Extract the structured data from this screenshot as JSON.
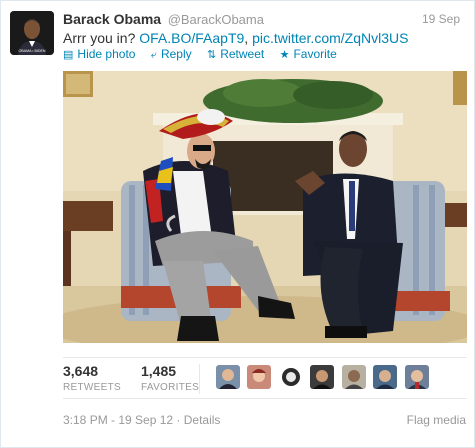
{
  "tweet": {
    "name": "Barack Obama",
    "handle": "@BarackObama",
    "date": "19 Sep",
    "text_prefix": "Arrr you in? ",
    "link1": "OFA.BO/FAapT9",
    "text_sep": ", ",
    "link2": "pic.twitter.com/ZqNvl3US",
    "avatar_caption": "OBAMA • BIDEN"
  },
  "actions": {
    "hide_photo": "Hide photo",
    "reply": "Reply",
    "retweet": "Retweet",
    "favorite": "Favorite"
  },
  "icons": {
    "hide_photo": "photo-icon",
    "reply": "reply-arrow-icon",
    "retweet": "retweet-icon",
    "favorite": "star-icon"
  },
  "stats": {
    "retweets_count": "3,648",
    "retweets_label": "RETWEETS",
    "favorites_count": "1,485",
    "favorites_label": "FAVORITES"
  },
  "footer": {
    "timestamp": "3:18 PM - 19 Sep 12",
    "separator": " · ",
    "details": "Details",
    "flag_media": "Flag media"
  },
  "colors": {
    "link": "#0084b4",
    "muted": "#999999",
    "text": "#333333"
  }
}
